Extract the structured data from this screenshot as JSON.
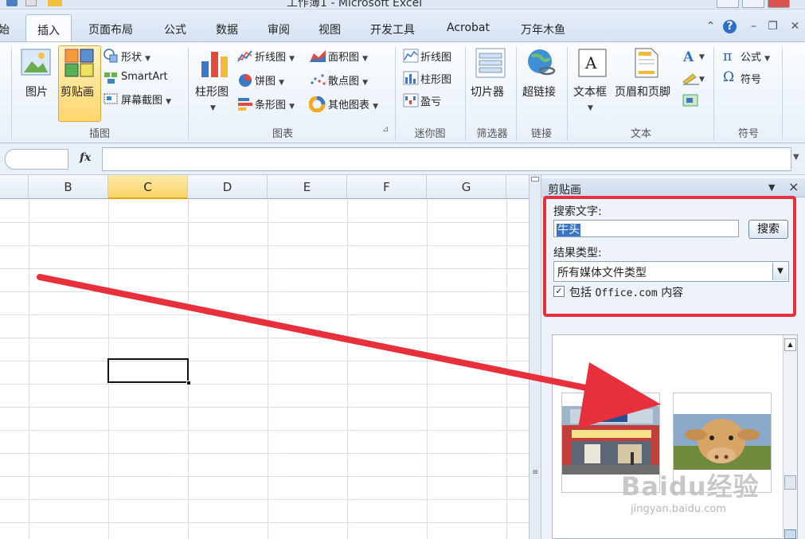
{
  "window": {
    "title": "工作簿1 - Microsoft Excel"
  },
  "tabs": [
    {
      "label": "始",
      "active": false
    },
    {
      "label": "插入",
      "active": true
    },
    {
      "label": "页面布局",
      "active": false
    },
    {
      "label": "公式",
      "active": false
    },
    {
      "label": "数据",
      "active": false
    },
    {
      "label": "审阅",
      "active": false
    },
    {
      "label": "视图",
      "active": false
    },
    {
      "label": "开发工具",
      "active": false
    },
    {
      "label": "Acrobat",
      "active": false
    },
    {
      "label": "万年木鱼",
      "active": false
    }
  ],
  "ribbon": {
    "illustrations": {
      "picture": "图片",
      "clipart": "剪贴画",
      "shapes": "形状",
      "smartart": "SmartArt",
      "screenshot": "屏幕截图",
      "group_label": "插图"
    },
    "charts": {
      "column": "柱形图",
      "line": "折线图",
      "pie": "饼图",
      "bar": "条形图",
      "area": "面积图",
      "scatter": "散点图",
      "other": "其他图表",
      "group_label": "图表"
    },
    "sparklines": {
      "line": "折线图",
      "column": "柱形图",
      "winloss": "盈亏",
      "group_label": "迷你图"
    },
    "filter": {
      "slicer": "切片器",
      "group_label": "筛选器"
    },
    "links": {
      "hyperlink": "超链接",
      "group_label": "链接"
    },
    "text": {
      "textbox": "文本框",
      "header_footer": "页眉和页脚",
      "group_label": "文本"
    },
    "symbols": {
      "equation": "公式",
      "symbol": "符号",
      "group_label": "符号"
    }
  },
  "formula_bar": {
    "fx_label": "fx",
    "value": ""
  },
  "grid": {
    "columns": [
      "B",
      "C",
      "D",
      "E",
      "F",
      "G"
    ],
    "selected_column": "C"
  },
  "task_pane": {
    "title": "剪贴画",
    "search_label": "搜索文字:",
    "search_value": "牛头",
    "search_button": "搜索",
    "result_type_label": "结果类型:",
    "result_type_value": "所有媒体文件类型",
    "include_prefix": "包括",
    "include_site": "Office.com",
    "include_suffix": "内容",
    "include_checked": true
  },
  "watermark": {
    "logo": "Baidu经验",
    "url": "jingyan.baidu.com"
  },
  "colors": {
    "highlight_box": "#e8303c",
    "selected_header": "#f8d46a",
    "ribbon_bg": "#e8f0fa"
  }
}
